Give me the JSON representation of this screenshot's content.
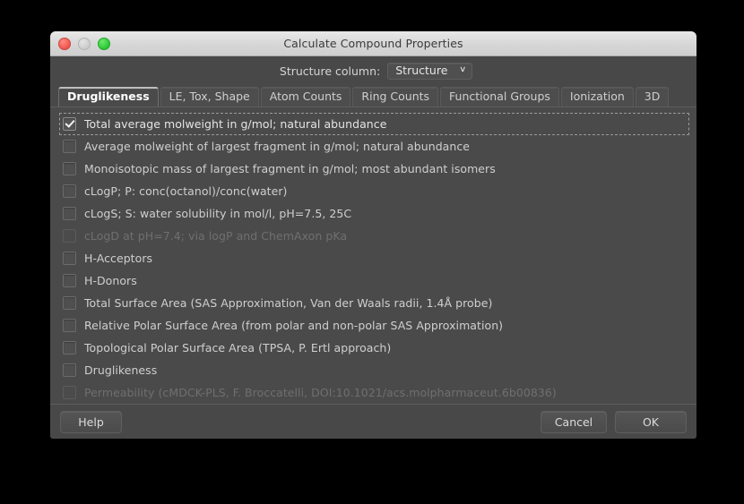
{
  "window": {
    "title": "Calculate Compound Properties",
    "controls": {
      "close": "close-button",
      "minimize": "minimize-button",
      "zoom": "zoom-button"
    }
  },
  "structure": {
    "label": "Structure column:",
    "selected": "Structure",
    "options": [
      "Structure"
    ],
    "chevron": "∨"
  },
  "tabs": [
    {
      "label": "Druglikeness",
      "active": true
    },
    {
      "label": "LE, Tox, Shape",
      "active": false
    },
    {
      "label": "Atom Counts",
      "active": false
    },
    {
      "label": "Ring Counts",
      "active": false
    },
    {
      "label": "Functional Groups",
      "active": false
    },
    {
      "label": "Ionization",
      "active": false
    },
    {
      "label": "3D",
      "active": false
    }
  ],
  "properties": [
    {
      "label": "Total average molweight in g/mol; natural abundance",
      "checked": true,
      "disabled": false,
      "focused": true
    },
    {
      "label": "Average molweight of largest fragment in g/mol; natural abundance",
      "checked": false,
      "disabled": false,
      "focused": false
    },
    {
      "label": "Monoisotopic mass of largest fragment in g/mol; most abundant isomers",
      "checked": false,
      "disabled": false,
      "focused": false
    },
    {
      "label": "cLogP; P: conc(octanol)/conc(water)",
      "checked": false,
      "disabled": false,
      "focused": false
    },
    {
      "label": "cLogS; S: water solubility in mol/l, pH=7.5, 25C",
      "checked": false,
      "disabled": false,
      "focused": false
    },
    {
      "label": "cLogD at pH=7.4; via logP and ChemAxon pKa",
      "checked": false,
      "disabled": true,
      "focused": false
    },
    {
      "label": "H-Acceptors",
      "checked": false,
      "disabled": false,
      "focused": false
    },
    {
      "label": "H-Donors",
      "checked": false,
      "disabled": false,
      "focused": false
    },
    {
      "label": "Total Surface Area (SAS Approximation, Van der Waals radii, 1.4Å probe)",
      "checked": false,
      "disabled": false,
      "focused": false
    },
    {
      "label": "Relative Polar Surface Area (from polar and non-polar SAS Approximation)",
      "checked": false,
      "disabled": false,
      "focused": false
    },
    {
      "label": "Topological Polar Surface Area (TPSA, P. Ertl approach)",
      "checked": false,
      "disabled": false,
      "focused": false
    },
    {
      "label": "Druglikeness",
      "checked": false,
      "disabled": false,
      "focused": false
    },
    {
      "label": "Permeability (cMDCK-PLS, F. Broccatelli, DOI:10.1021/acs.molpharmaceut.6b00836)",
      "checked": false,
      "disabled": true,
      "focused": false
    }
  ],
  "buttons": {
    "help": "Help",
    "cancel": "Cancel",
    "ok": "OK"
  },
  "colors": {
    "window_bg": "#484848",
    "panel_bg": "#4a4a4a",
    "titlebar_bg": "#d6d6d6",
    "text": "#cfcfcf",
    "desktop_bg": "#000000",
    "close_red": "#f0554c",
    "minimize_gray": "#cccccc",
    "zoom_green": "#29c832"
  }
}
